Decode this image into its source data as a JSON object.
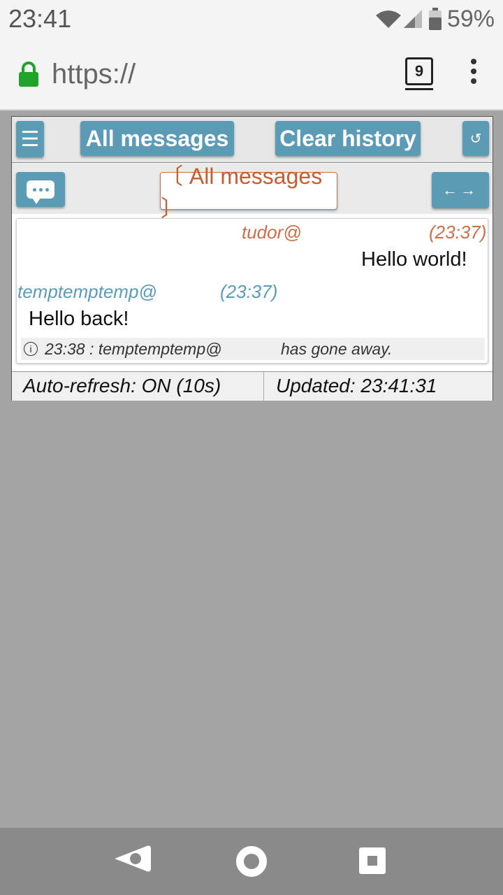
{
  "status_bar": {
    "time": "23:41",
    "battery_percent": "59%",
    "icons": [
      "wifi-icon",
      "signal-icon",
      "battery-icon"
    ]
  },
  "browser": {
    "url": "https://",
    "tab_count": "9"
  },
  "toolbar": {
    "all_messages_label": "All messages",
    "clear_history_label": "Clear history",
    "menu_icon": "☰",
    "refresh_icon": "↺"
  },
  "subbar": {
    "filter_label": "〔 All messages 〕",
    "arrows_label": "←→"
  },
  "messages": [
    {
      "user": "tudor@",
      "time": "(23:37)",
      "text": "Hello world!",
      "align": "right",
      "color": "#c9704a"
    },
    {
      "user": "temptemptemp@",
      "time": "(23:37)",
      "text": "Hello back!",
      "align": "left",
      "color": "#5b9bb5"
    }
  ],
  "system_message": {
    "time_user": "23:38 : temptemptemp@",
    "text": "has gone away."
  },
  "footer": {
    "auto_refresh": "Auto-refresh: ON (10s)",
    "updated": "Updated: 23:41:31"
  },
  "colors": {
    "accent": "#5b9bb5",
    "highlight": "#c9704a",
    "background": "#a4a4a4"
  }
}
